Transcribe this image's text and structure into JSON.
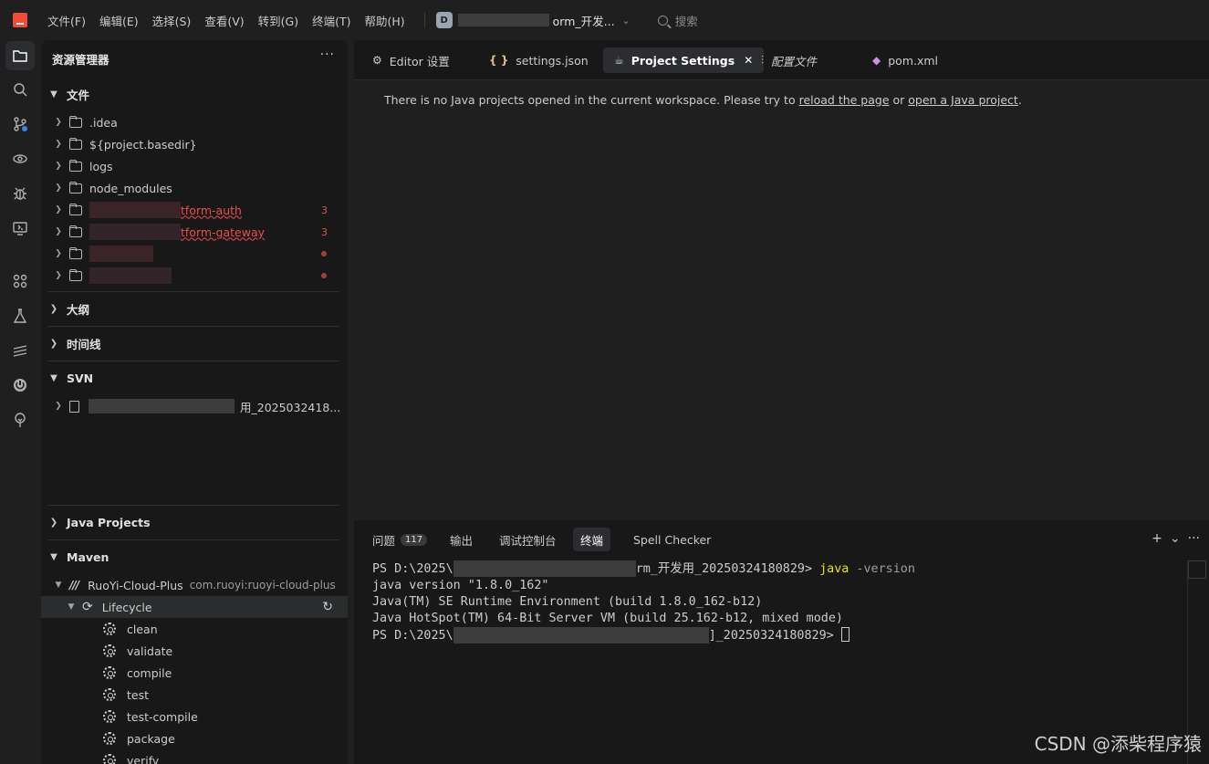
{
  "menubar": [
    "文件(F)",
    "编辑(E)",
    "选择(S)",
    "查看(V)",
    "转到(G)",
    "终端(T)",
    "帮助(H)"
  ],
  "project": {
    "avatar": "D",
    "name": "orm_开发..."
  },
  "search": {
    "placeholder": "搜索"
  },
  "activity_icons": [
    "explorer-icon",
    "search-icon",
    "source-control-icon",
    "remote-explorer-icon",
    "debug-icon",
    "remote-display-icon",
    "extensions-icon",
    "testing-icon",
    "kubernetes-icon",
    "spring-icon",
    "tree-icon"
  ],
  "sidebar": {
    "title": "资源管理器",
    "more": "···",
    "files_section": "文件",
    "files": [
      {
        "label": ".idea"
      },
      {
        "label": "${project.basedir}"
      },
      {
        "label": "logs"
      },
      {
        "label": "node_modules"
      },
      {
        "label": "tform-auth",
        "badge": "3"
      },
      {
        "label": "tform-gateway",
        "badge": "3"
      },
      {
        "label": "",
        "dot": true
      },
      {
        "label": "",
        "dot": true
      }
    ],
    "outline_section": "大纲",
    "timeline_section": "时间线",
    "svn_section": "SVN",
    "svn_item": "用_2025032418...",
    "java_projects_section": "Java Projects",
    "maven_section": "Maven",
    "maven_project": {
      "name": "RuoYi-Cloud-Plus",
      "artifact": "com.ruoyi:ruoyi-cloud-plus"
    },
    "lifecycle_label": "Lifecycle",
    "lifecycle_phases": [
      "clean",
      "validate",
      "compile",
      "test",
      "test-compile",
      "package",
      "verify"
    ]
  },
  "tabs": [
    {
      "label": "Editor 设置",
      "icon": "gear-icon"
    },
    {
      "label": "settings.json",
      "icon": "json-icon",
      "icon_text": "{ }"
    },
    {
      "label": "Project Settings",
      "icon": "coffee-icon",
      "active": true,
      "close": "✕"
    },
    {
      "label": "配置文件",
      "icon": "settings-sliders-icon"
    },
    {
      "label": "pom.xml",
      "icon": "pom-icon"
    }
  ],
  "editor": {
    "message_prefix": "There is no Java projects opened in the current workspace. Please try to ",
    "link1": "reload the page",
    "message_middle": " or ",
    "link2": "open a Java project",
    "message_suffix": "."
  },
  "panel": {
    "tabs": [
      {
        "label": "问题",
        "count": "117"
      },
      {
        "label": "输出"
      },
      {
        "label": "调试控制台"
      },
      {
        "label": "终端",
        "active": true
      },
      {
        "label": "Spell Checker"
      }
    ],
    "actions": {
      "add": "+",
      "dropdown": "⌄",
      "more": "···"
    }
  },
  "terminal": {
    "line1_prefix": "PS D:\\2025\\",
    "line1_suffix": "rm_开发用_20250324180829> ",
    "cmd": "java",
    "arg": " -version",
    "line2": "java version \"1.8.0_162\"",
    "line3": "Java(TM) SE Runtime Environment (build 1.8.0_162-b12)",
    "line4": "Java HotSpot(TM) 64-Bit Server VM (build 25.162-b12, mixed mode)",
    "line5_prefix": "PS D:\\2025\\",
    "line5_suffix": "]_20250324180829> "
  },
  "watermark": "CSDN @添柴程序猿",
  "colors": {
    "error": "#f14c4c",
    "terminal_command": "#e5e510",
    "logo": "#f14c36"
  }
}
